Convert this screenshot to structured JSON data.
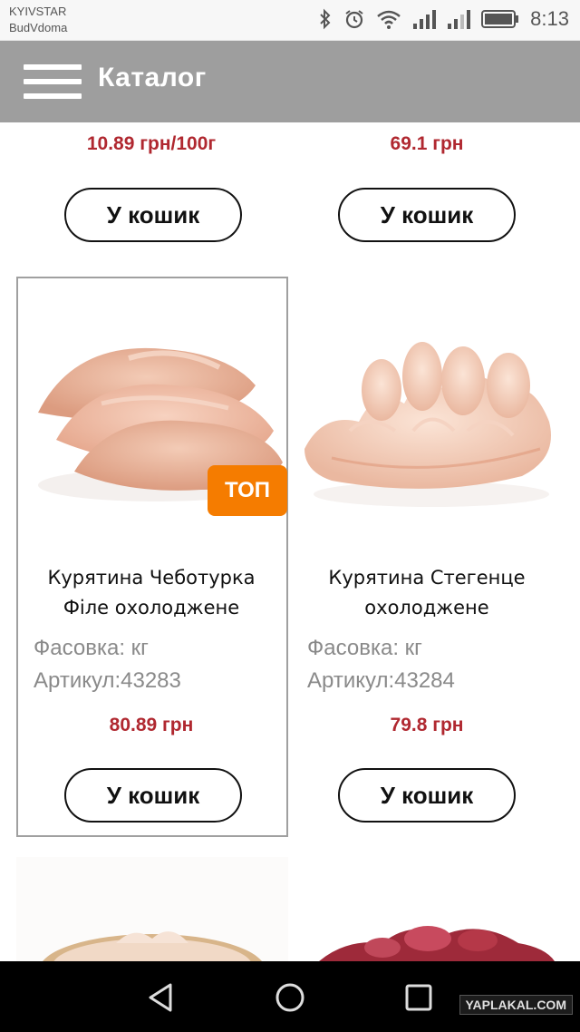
{
  "status_bar": {
    "carrier_line1": "KYIVSTAR",
    "carrier_line2": "BudVdoma",
    "time": "8:13",
    "icons": [
      "bluetooth-icon",
      "alarm-icon",
      "wifi-icon",
      "signal-icon",
      "signal-icon-2",
      "battery-icon"
    ]
  },
  "app_bar": {
    "title": "Каталог",
    "menu_icon": "hamburger-menu-icon",
    "color": "#9e9e9e"
  },
  "products_top_row": [
    {
      "price": "10.89 грн/100г",
      "button": "У кошик"
    },
    {
      "price": "69.1 грн",
      "button": "У кошик"
    }
  ],
  "products": [
    {
      "name_line1": "Курятина Чеботурка",
      "name_line2": "Філе охолоджене",
      "packaging": "Фасовка: кг",
      "article": "Артикул:43283",
      "price": "80.89 грн",
      "button": "У кошик",
      "badge": "ТОП",
      "selected": true
    },
    {
      "name_line1": "Курятина Стегенце",
      "name_line2": "охолоджене",
      "packaging": "Фасовка: кг",
      "article": "Артикул:43284",
      "price": "79.8 грн",
      "button": "У кошик"
    }
  ],
  "colors": {
    "price": "#b02830",
    "badge": "#f57c00",
    "meta_text": "#8a8a8a"
  },
  "nav_bar": {
    "icons": [
      "back-triangle-icon",
      "home-circle-icon",
      "recents-square-icon"
    ]
  },
  "watermark": "YAPLAKAL.COM"
}
